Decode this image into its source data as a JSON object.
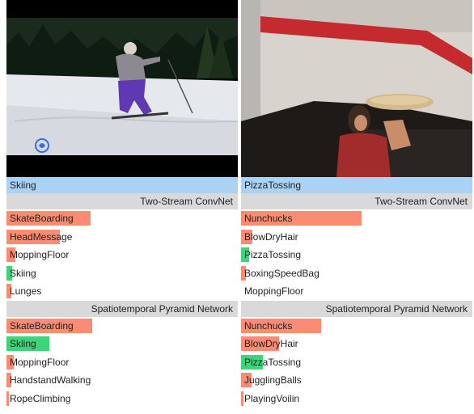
{
  "colors": {
    "truth_bg": "#a9d2f5",
    "method_bg": "#d9d9d9",
    "wrong_bar": "#f98c72",
    "correct_bar": "#3dd47a"
  },
  "panels": [
    {
      "ground_truth": "Skiing",
      "scene": "video frame of a skier on a snowy slope at night (black letterbox above and below)",
      "methods": [
        {
          "name": "Two-Stream ConvNet",
          "predictions": [
            {
              "label": "SkateBoarding",
              "score": 0.365,
              "correct": false
            },
            {
              "label": "HeadMessage",
              "score": 0.23,
              "correct": false
            },
            {
              "label": "MoppingFloor",
              "score": 0.04,
              "correct": false
            },
            {
              "label": "Skiing",
              "score": 0.025,
              "correct": true
            },
            {
              "label": "Lunges",
              "score": 0.02,
              "correct": false
            }
          ]
        },
        {
          "name": "Spatiotemporal Pyramid Network",
          "predictions": [
            {
              "label": "SkateBoarding",
              "score": 0.37,
              "correct": false
            },
            {
              "label": "Skiing",
              "score": 0.185,
              "correct": true
            },
            {
              "label": "MoppingFloor",
              "score": 0.03,
              "correct": false
            },
            {
              "label": "HandstandWalking",
              "score": 0.02,
              "correct": false
            },
            {
              "label": "RopeClimbing",
              "score": 0.012,
              "correct": false
            }
          ]
        }
      ]
    },
    {
      "ground_truth": "PizzaTossing",
      "scene": "video frame of a man tossing pizza dough in a kitchen with a red stripe on the wall",
      "methods": [
        {
          "name": "Two-Stream ConvNet",
          "predictions": [
            {
              "label": "Nunchucks",
              "score": 0.52,
              "correct": false
            },
            {
              "label": "BlowDryHair",
              "score": 0.05,
              "correct": false
            },
            {
              "label": "PizzaTossing",
              "score": 0.035,
              "correct": true
            },
            {
              "label": "BoxingSpeedBag",
              "score": 0.02,
              "correct": false
            },
            {
              "label": "MoppingFloor",
              "score": 0.0,
              "correct": false
            }
          ]
        },
        {
          "name": "Spatiotemporal Pyramid Network",
          "predictions": [
            {
              "label": "Nunchucks",
              "score": 0.345,
              "correct": false
            },
            {
              "label": "BlowDryHair",
              "score": 0.165,
              "correct": false
            },
            {
              "label": "PizzaTossing",
              "score": 0.095,
              "correct": true
            },
            {
              "label": "JugglingBalls",
              "score": 0.045,
              "correct": false
            },
            {
              "label": "PlayingVoilin",
              "score": 0.01,
              "correct": false
            }
          ]
        }
      ]
    }
  ]
}
